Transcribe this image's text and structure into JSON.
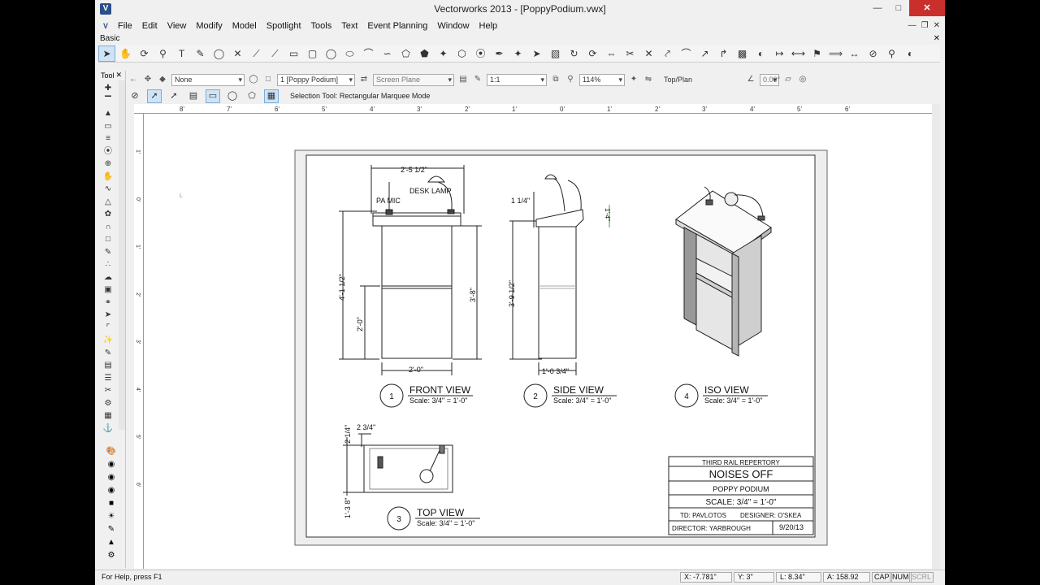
{
  "window": {
    "title": "Vectorworks 2013 - [PoppyPodium.vwx]",
    "app_icon": "V"
  },
  "menu": {
    "items": [
      "File",
      "Edit",
      "View",
      "Modify",
      "Model",
      "Spotlight",
      "Tools",
      "Text",
      "Event Planning",
      "Window",
      "Help"
    ]
  },
  "basic_palette": {
    "label": "Basic"
  },
  "tool_palette": {
    "label": "Tool"
  },
  "viewbar": {
    "class_value": "None",
    "layer_value": "1 [Poppy Podium]",
    "plane_value": "Screen Plane",
    "scale_value": "1:1",
    "zoom_value": "114%",
    "view_value": "Top/Plan",
    "angle_value": "0.00°"
  },
  "modebar": {
    "mode_text": "Selection Tool: Rectangular Marquee Mode"
  },
  "ruler": {
    "h_ticks": [
      "8'",
      "7'",
      "6'",
      "5'",
      "4'",
      "3'",
      "2'",
      "1'",
      "0'",
      "1'",
      "2'",
      "3'",
      "4'",
      "5'",
      "6'"
    ],
    "v_ticks": [
      "1'",
      "0'",
      "1'",
      "2'",
      "3'",
      "4'",
      "5'",
      "6'"
    ]
  },
  "drawing": {
    "front_view": {
      "dim_top": "2'-5 1/2\"",
      "label_lamp": "DESK LAMP",
      "label_mic": "PA MIC",
      "dim_left_total": "4'-1 1/2\"",
      "dim_left_shelf": "2'-0\"",
      "dim_right": "3'-8\"",
      "dim_bottom": "2'-0\"",
      "number": "1",
      "title": "FRONT VIEW",
      "scale": "Scale: 3/4\" = 1'-0\""
    },
    "side_view": {
      "dim_top": "1 1/4\"",
      "dim_slope": "1'-4\"",
      "dim_left": "3'-9 1/2\"",
      "dim_bottom": "1'-0 3/4\"",
      "number": "2",
      "title": "SIDE VIEW",
      "scale": "Scale: 3/4\" = 1'-0\""
    },
    "iso_view": {
      "number": "4",
      "title": "ISO VIEW",
      "scale": "Scale: 3/4\" = 1'-0\""
    },
    "top_view": {
      "dim_top": "2 3/4\"",
      "dim_left_top": "2 1/4\"",
      "dim_left": "1'-3 8\"",
      "number": "3",
      "title": "TOP VIEW",
      "scale": "Scale: 3/4\" = 1'-0\""
    },
    "title_block": {
      "company": "THIRD RAIL REPERTORY",
      "show": "NOISES OFF",
      "item": "POPPY PODIUM",
      "scale": "SCALE: 3/4\" = 1'-0\"",
      "td": "TD: PAVLOTOS",
      "designer": "DESIGNER: O'SKEA",
      "director": "DIRECTOR: YARBROUGH",
      "date": "9/20/13"
    }
  },
  "status": {
    "help_text": "For Help, press F1",
    "x": "X: -7.781\"",
    "y": "Y: 3\"",
    "l": "L: 8.34\"",
    "a": "A: 158.92",
    "keys": [
      "CAP",
      "NUM",
      "SCRL"
    ]
  }
}
